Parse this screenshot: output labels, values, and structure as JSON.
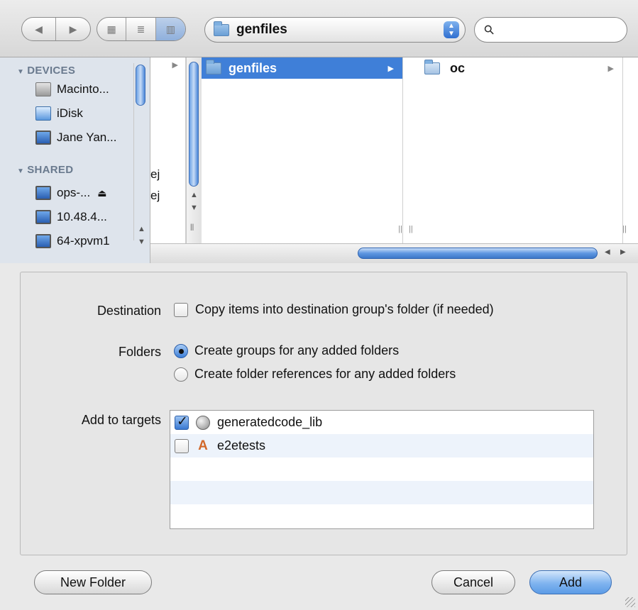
{
  "toolbar": {
    "back_icon": "◀",
    "forward_icon": "▶",
    "view_icons": [
      "▦",
      "≣",
      "▥"
    ],
    "location": "genfiles",
    "stepper_up": "▲",
    "stepper_down": "▼",
    "search_icon": "⚲",
    "search_value": ""
  },
  "sidebar": {
    "devices_header": "DEVICES",
    "shared_header": "SHARED",
    "header_triangle": "▼",
    "devices": [
      "Macinto...",
      "iDisk",
      "Jane Yan..."
    ],
    "shared": [
      {
        "label": "ops-...",
        "eject": "⏏"
      },
      {
        "label": "10.48.4..."
      },
      {
        "label": "64-xpvm1"
      }
    ]
  },
  "browser": {
    "col1_partial": [
      "ej",
      "ej"
    ],
    "col2_selected": "genfiles",
    "col3_item": "oc",
    "arrow": "▶",
    "scroll_up": "▲",
    "scroll_down": "▼",
    "resize_glyph": "||",
    "hscroll_left": "◀",
    "hscroll_right": "▶"
  },
  "options": {
    "destination_label": "Destination",
    "copy_items_label": "Copy items into destination group's folder (if needed)",
    "copy_items_checked": false,
    "folders_label": "Folders",
    "folder_options": [
      {
        "label": "Create groups for any added folders",
        "selected": true
      },
      {
        "label": "Create folder references for any added folders",
        "selected": false
      }
    ],
    "targets_label": "Add to targets",
    "targets": [
      {
        "name": "generatedcode_lib",
        "checked": true,
        "icon": "library-icon"
      },
      {
        "name": "e2etests",
        "checked": false,
        "icon": "app-target-icon"
      }
    ]
  },
  "buttons": {
    "new_folder": "New Folder",
    "cancel": "Cancel",
    "add": "Add"
  },
  "colors": {
    "selection": "#3f7fd8",
    "sidebar_bg": "#dee4ec",
    "default_button": "#7fb3ef"
  }
}
